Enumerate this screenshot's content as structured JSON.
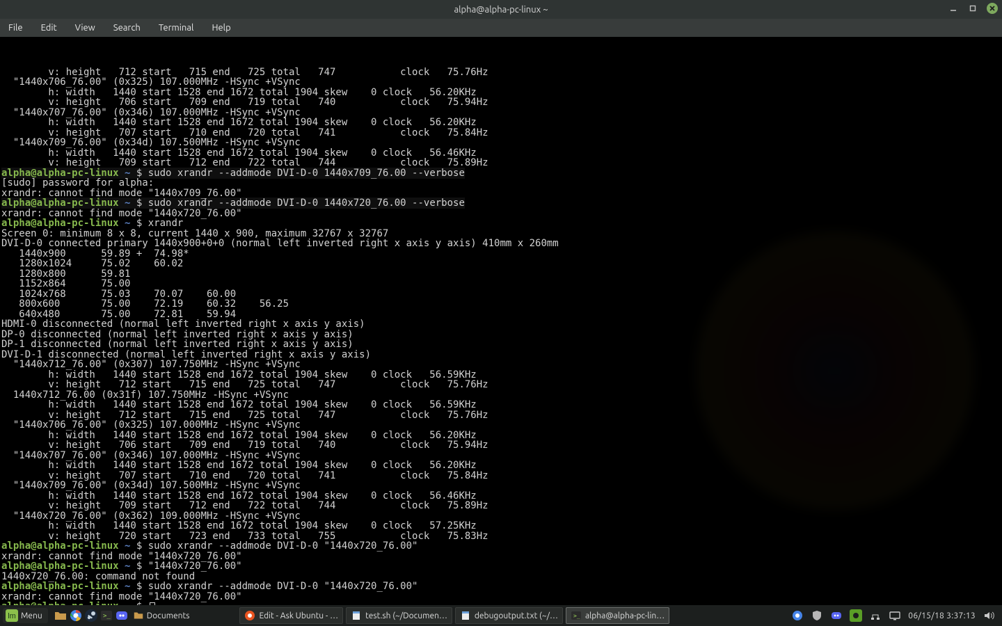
{
  "titlebar": {
    "title": "alpha@alpha-pc-linux ~"
  },
  "menubar": {
    "items": [
      "File",
      "Edit",
      "View",
      "Search",
      "Terminal",
      "Help"
    ]
  },
  "prompt": {
    "user_host": "alpha@alpha-pc-linux",
    "path": "~",
    "sep": "$"
  },
  "term": {
    "top_block": [
      "        v: height   712 start   715 end   725 total   747           clock   75.76Hz",
      "  \"1440x706_76.00\" (0x325) 107.000MHz -HSync +VSync",
      "        h: width   1440 start 1528 end 1672 total 1904 skew    0 clock   56.20KHz",
      "        v: height   706 start   709 end   719 total   740           clock   75.94Hz",
      "  \"1440x707_76.00\" (0x346) 107.000MHz -HSync +VSync",
      "        h: width   1440 start 1528 end 1672 total 1904 skew    0 clock   56.20KHz",
      "        v: height   707 start   710 end   720 total   741           clock   75.84Hz",
      "  \"1440x709_76.00\" (0x34d) 107.500MHz -HSync +VSync",
      "        h: width   1440 start 1528 end 1672 total 1904 skew    0 clock   56.46KHz",
      "        v: height   709 start   712 end   722 total   744           clock   75.89Hz"
    ],
    "cmd1": "sudo xrandr --addmode DVI-D-0 1440x709_76.00 --verbose",
    "after_cmd1": [
      "[sudo] password for alpha:",
      "xrandr: cannot find mode \"1440x709_76.00\""
    ],
    "cmd2": "sudo xrandr --addmode DVI-D-0 1440x720_76.00 --verbose",
    "after_cmd2": [
      "xrandr: cannot find mode \"1440x720_76.00\""
    ],
    "cmd3": "xrandr",
    "xrandr_out": [
      "Screen 0: minimum 8 x 8, current 1440 x 900, maximum 32767 x 32767",
      "DVI-D-0 connected primary 1440x900+0+0 (normal left inverted right x axis y axis) 410mm x 260mm",
      "   1440x900      59.89 +  74.98*",
      "   1280x1024     75.02    60.02",
      "   1280x800      59.81",
      "   1152x864      75.00",
      "   1024x768      75.03    70.07    60.00",
      "   800x600       75.00    72.19    60.32    56.25",
      "   640x480       75.00    72.81    59.94",
      "HDMI-0 disconnected (normal left inverted right x axis y axis)",
      "DP-0 disconnected (normal left inverted right x axis y axis)",
      "DP-1 disconnected (normal left inverted right x axis y axis)",
      "DVI-D-1 disconnected (normal left inverted right x axis y axis)",
      "  \"1440x712_76.00\" (0x307) 107.750MHz -HSync +VSync",
      "        h: width   1440 start 1528 end 1672 total 1904 skew    0 clock   56.59KHz",
      "        v: height   712 start   715 end   725 total   747           clock   75.76Hz",
      "  1440x712_76.00 (0x31f) 107.750MHz -HSync +VSync",
      "        h: width   1440 start 1528 end 1672 total 1904 skew    0 clock   56.59KHz",
      "        v: height   712 start   715 end   725 total   747           clock   75.76Hz",
      "  \"1440x706_76.00\" (0x325) 107.000MHz -HSync +VSync",
      "        h: width   1440 start 1528 end 1672 total 1904 skew    0 clock   56.20KHz",
      "        v: height   706 start   709 end   719 total   740           clock   75.94Hz",
      "  \"1440x707_76.00\" (0x346) 107.000MHz -HSync +VSync",
      "        h: width   1440 start 1528 end 1672 total 1904 skew    0 clock   56.20KHz",
      "        v: height   707 start   710 end   720 total   741           clock   75.84Hz",
      "  \"1440x709_76.00\" (0x34d) 107.500MHz -HSync +VSync",
      "        h: width   1440 start 1528 end 1672 total 1904 skew    0 clock   56.46KHz",
      "        v: height   709 start   712 end   722 total   744           clock   75.89Hz",
      "  \"1440x720_76.00\" (0x362) 109.000MHz -HSync +VSync",
      "        h: width   1440 start 1528 end 1672 total 1904 skew    0 clock   57.25KHz",
      "        v: height   720 start   723 end   733 total   755           clock   75.83Hz"
    ],
    "cmd4": "sudo xrandr --addmode DVI-D-0 \"1440x720_76.00\"",
    "after_cmd4": [
      "xrandr: cannot find mode \"1440x720_76.00\""
    ],
    "cmd5": "\"1440x720_76.00\"",
    "after_cmd5": [
      "1440x720_76.00: command not found"
    ],
    "cmd6": "sudo xrandr --addmode DVI-D-0 \"1440x720_76.00\"",
    "after_cmd6": [
      "xrandr: cannot find mode \"1440x720_76.00\""
    ]
  },
  "taskbar": {
    "menu_label": "Menu",
    "quicklaunch": [
      "files-icon",
      "chrome-icon",
      "steam-icon",
      "terminal-icon",
      "discord-icon",
      "folder-documents-icon"
    ],
    "documents_label": "Documents",
    "items": [
      {
        "icon": "askubuntu-icon",
        "label": "Edit - Ask Ubuntu - …"
      },
      {
        "icon": "gedit-icon",
        "label": "test.sh (~/Documen…"
      },
      {
        "icon": "gedit-icon",
        "label": "debugoutput.txt (~/…"
      },
      {
        "icon": "terminal-icon",
        "label": "alpha@alpha-pc-lin…"
      }
    ],
    "active_index": 3,
    "clock": "06/15/18 3:37:13",
    "tray": [
      "chrome-icon",
      "shield-icon",
      "discord-icon",
      "nvidia-icon",
      "network-icon",
      "display-icon"
    ],
    "volume_icon": "volume-icon"
  }
}
